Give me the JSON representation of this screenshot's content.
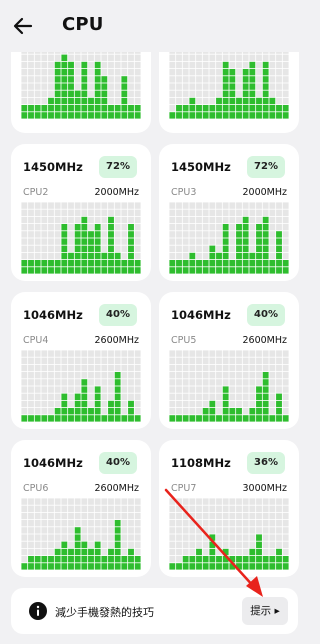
{
  "header": {
    "title": "CPU"
  },
  "colors": {
    "bar": "#2ebd2e",
    "grid": "#e6e6e6",
    "badge_bg": "#d6f5df",
    "arrow": "#e8231c"
  },
  "cores": [
    {
      "freq": "",
      "load": "",
      "name": "",
      "max": "",
      "history": [
        2,
        2,
        2,
        2,
        3,
        8,
        9,
        8,
        4,
        8,
        3,
        8,
        6,
        2,
        2,
        6,
        2,
        2
      ]
    },
    {
      "freq": "",
      "load": "",
      "name": "",
      "max": "",
      "history": [
        1,
        2,
        2,
        3,
        2,
        2,
        2,
        3,
        8,
        7,
        3,
        7,
        8,
        3,
        8,
        3,
        2,
        2
      ]
    },
    {
      "freq": "1450MHz",
      "load": "72%",
      "name": "CPU2",
      "max": "2000MHz",
      "history": [
        2,
        2,
        2,
        2,
        2,
        2,
        7,
        3,
        7,
        8,
        6,
        7,
        3,
        8,
        3,
        2,
        7,
        2
      ]
    },
    {
      "freq": "1450MHz",
      "load": "72%",
      "name": "CPU3",
      "max": "2000MHz",
      "history": [
        2,
        2,
        2,
        3,
        2,
        2,
        4,
        3,
        7,
        2,
        7,
        8,
        3,
        7,
        8,
        2,
        6,
        2
      ]
    },
    {
      "freq": "1046MHz",
      "load": "40%",
      "name": "CPU4",
      "max": "2600MHz",
      "history": [
        1,
        1,
        1,
        1,
        1,
        2,
        4,
        2,
        4,
        6,
        2,
        5,
        1,
        3,
        7,
        1,
        3,
        1
      ]
    },
    {
      "freq": "1046MHz",
      "load": "40%",
      "name": "CPU5",
      "max": "2600MHz",
      "history": [
        1,
        1,
        1,
        1,
        1,
        2,
        3,
        1,
        5,
        2,
        2,
        1,
        2,
        5,
        7,
        1,
        4,
        1
      ]
    },
    {
      "freq": "1046MHz",
      "load": "40%",
      "name": "CPU6",
      "max": "2600MHz",
      "history": [
        1,
        2,
        2,
        2,
        2,
        3,
        4,
        3,
        6,
        4,
        3,
        4,
        2,
        3,
        7,
        2,
        3,
        2
      ]
    },
    {
      "freq": "1108MHz",
      "load": "36%",
      "name": "CPU7",
      "max": "3000MHz",
      "history": [
        1,
        1,
        2,
        2,
        3,
        2,
        5,
        2,
        3,
        2,
        2,
        2,
        3,
        5,
        2,
        2,
        3,
        2
      ]
    }
  ],
  "tip": {
    "text": "減少手機發熱的技巧",
    "button_label": "提示 ▸",
    "icon": "info-icon"
  }
}
